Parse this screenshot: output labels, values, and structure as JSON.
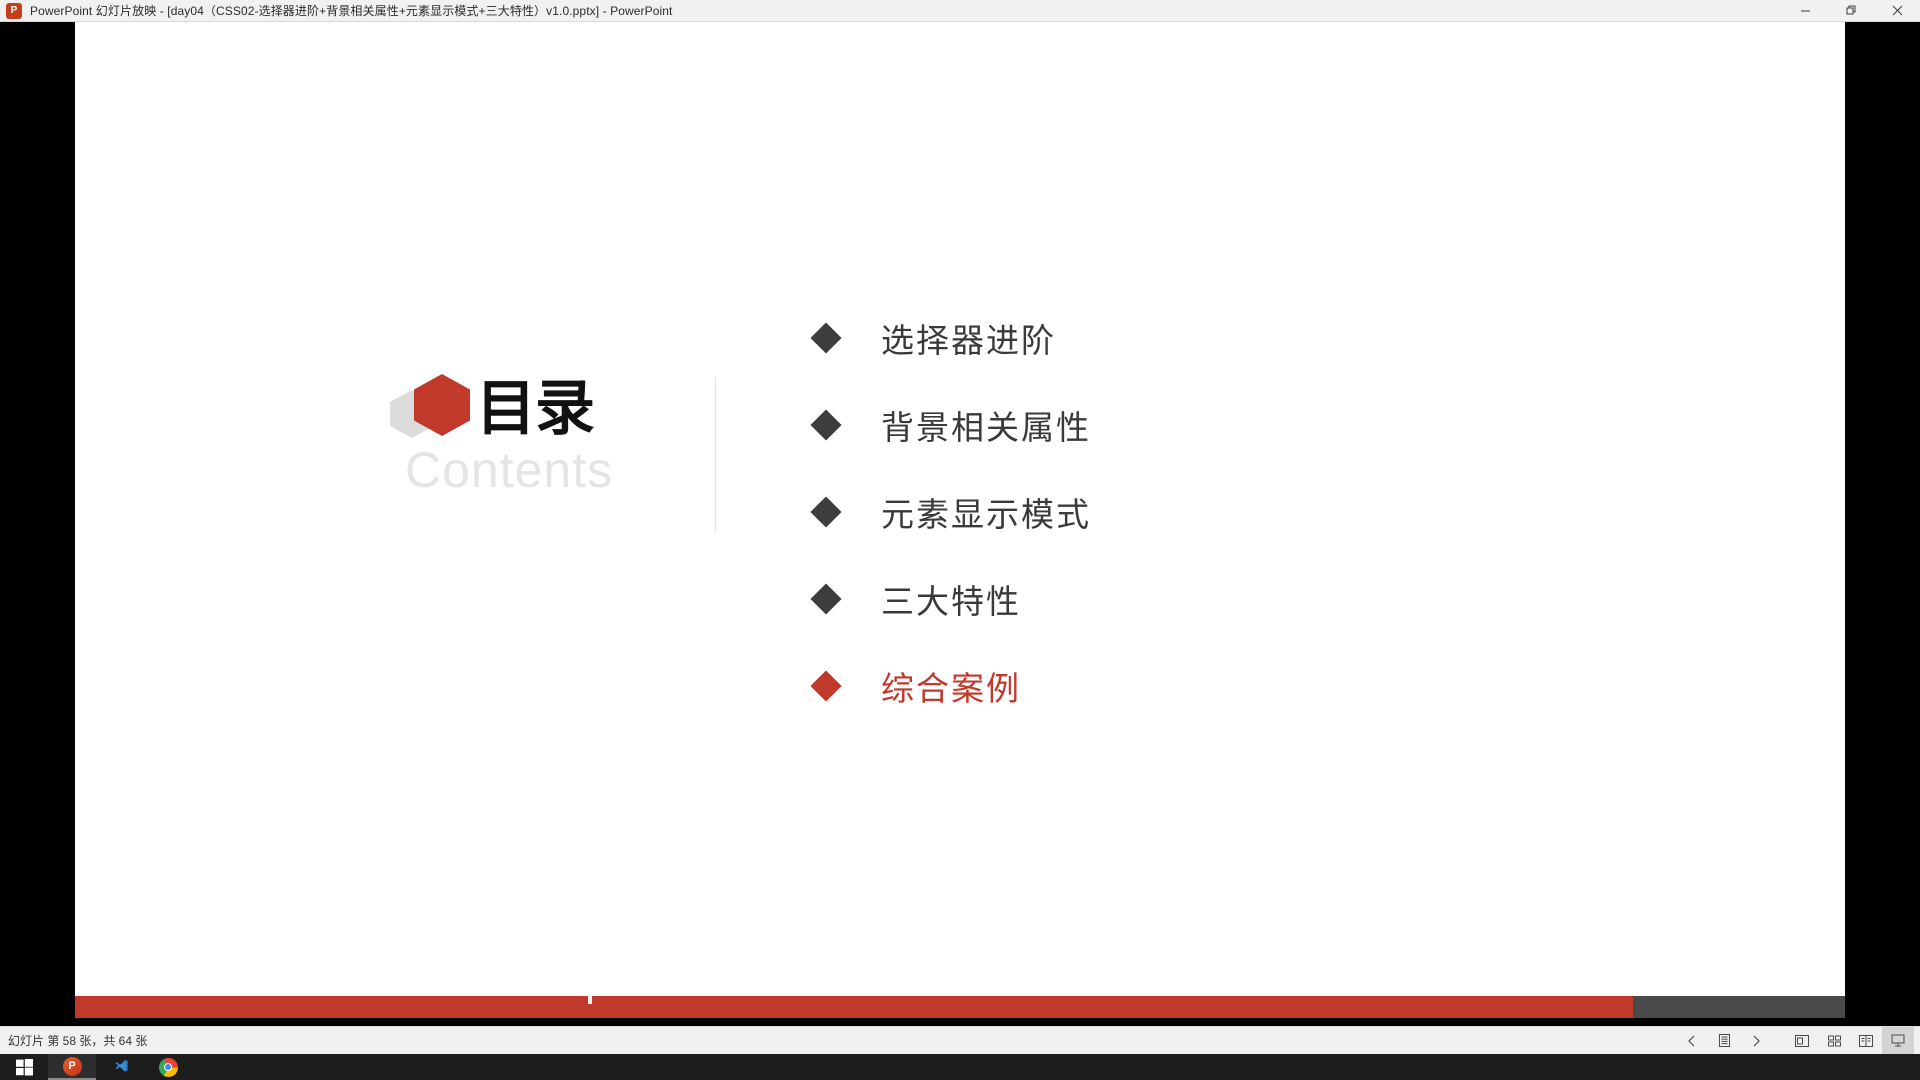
{
  "window": {
    "app_icon": "powerpoint-icon",
    "title": "PowerPoint 幻灯片放映 - [day04（CSS02-选择器进阶+背景相关属性+元素显示模式+三大特性）v1.0.pptx] - PowerPoint",
    "minimize_label": "最小化",
    "restore_label": "向下还原",
    "close_label": "关闭"
  },
  "slide": {
    "contents": {
      "title_cn": "目录",
      "title_en": "Contents",
      "logo_colors": {
        "primary": "#c0392b",
        "secondary": "#dcdcdc"
      }
    },
    "items": [
      {
        "label": "选择器进阶",
        "color": "#3a3a3a",
        "bullet_color": "#3d3d3d"
      },
      {
        "label": "背景相关属性",
        "color": "#3a3a3a",
        "bullet_color": "#3d3d3d"
      },
      {
        "label": "元素显示模式",
        "color": "#3a3a3a",
        "bullet_color": "#3d3d3d"
      },
      {
        "label": "三大特性",
        "color": "#3a3a3a",
        "bullet_color": "#3d3d3d"
      },
      {
        "label": "综合案例",
        "color": "#c0392b",
        "bullet_color": "#c0392b"
      }
    ],
    "progress": {
      "percent": 88,
      "fill_color": "#c0392b",
      "track_color": "#4a4a4a",
      "nub_position_percent": 29
    }
  },
  "statusbar": {
    "slide_status": "幻灯片 第 58 张，共 64 张",
    "current_slide": 58,
    "total_slides": 64,
    "controls": [
      {
        "name": "previous-slide",
        "glyph": "‹"
      },
      {
        "name": "notes",
        "glyph": "▤"
      },
      {
        "name": "next-slide",
        "glyph": "›"
      },
      {
        "name": "normal-view",
        "glyph": "▣"
      },
      {
        "name": "slide-sorter",
        "glyph": "▦"
      },
      {
        "name": "reading-view",
        "glyph": "▥"
      },
      {
        "name": "slideshow",
        "glyph": "▭",
        "active": true
      }
    ]
  },
  "taskbar": {
    "items": [
      {
        "name": "start-button",
        "label": "开始"
      },
      {
        "name": "powerpoint-task",
        "label": "PowerPoint",
        "running": true
      },
      {
        "name": "vscode-task",
        "label": "Visual Studio Code"
      },
      {
        "name": "chrome-task",
        "label": "Google Chrome"
      }
    ]
  }
}
